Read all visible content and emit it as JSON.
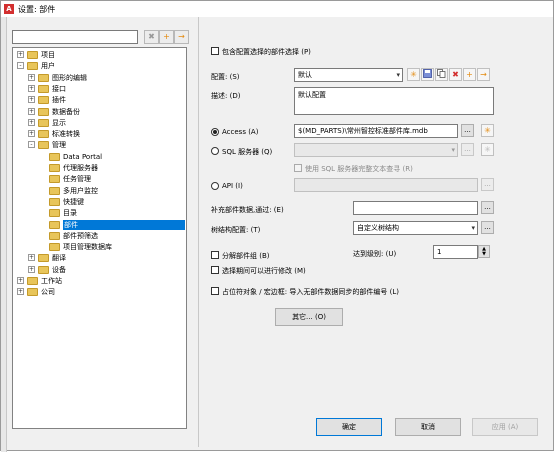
{
  "window": {
    "title": "设置: 部件",
    "app_icon_letter": "A"
  },
  "toolbar": {
    "delete_icon": "✖",
    "add_icon": "+",
    "export_icon": "→"
  },
  "tree": {
    "items": [
      {
        "label": "项目",
        "expander": "+",
        "level": 0
      },
      {
        "label": "用户",
        "expander": "-",
        "level": 0
      },
      {
        "label": "图形的编辑",
        "expander": "+",
        "level": 1
      },
      {
        "label": "接口",
        "expander": "+",
        "level": 1
      },
      {
        "label": "插件",
        "expander": "+",
        "level": 1
      },
      {
        "label": "数据备份",
        "expander": "+",
        "level": 1
      },
      {
        "label": "显示",
        "expander": "+",
        "level": 1
      },
      {
        "label": "标准转换",
        "expander": "+",
        "level": 1
      },
      {
        "label": "管理",
        "expander": "-",
        "level": 1
      },
      {
        "label": "Data Portal",
        "expander": "",
        "level": 2
      },
      {
        "label": "代理服务器",
        "expander": "",
        "level": 2
      },
      {
        "label": "任务管理",
        "expander": "",
        "level": 2
      },
      {
        "label": "多用户监控",
        "expander": "",
        "level": 2
      },
      {
        "label": "快捷键",
        "expander": "",
        "level": 2
      },
      {
        "label": "目录",
        "expander": "",
        "level": 2
      },
      {
        "label": "部件",
        "expander": "",
        "level": 2,
        "selected": true
      },
      {
        "label": "部件预筛选",
        "expander": "",
        "level": 2
      },
      {
        "label": "项目管理数据库",
        "expander": "",
        "level": 2
      },
      {
        "label": "翻译",
        "expander": "+",
        "level": 1
      },
      {
        "label": "设备",
        "expander": "+",
        "level": 1
      },
      {
        "label": "工作站",
        "expander": "+",
        "level": 0
      },
      {
        "label": "公司",
        "expander": "+",
        "level": 0
      }
    ]
  },
  "form": {
    "include_config_label": "包含配置选择的部件选择 (P)",
    "config_label": "配置: (S)",
    "config_value": "默认",
    "desc_label": "描述: (D)",
    "desc_value": "默认配置",
    "access_label": "Access (A)",
    "access_value": "$(MD_PARTS)\\常州智控标准部件库.mdb",
    "sql_label": "SQL 服务器 (Q)",
    "sql_value": "",
    "sql_compat_label": "使用 SQL 服务器完整文本查寻 (R)",
    "api_label": "API (I)",
    "api_value": "",
    "supplement_label": "补充部件数据,通过: (E)",
    "supplement_value": "",
    "struct_label": "树结构配置: (T)",
    "struct_value": "自定义树结构",
    "decompose_label": "分解部件组 (B)",
    "level_label": "达到级别: (U)",
    "level_value": "1",
    "select_period_label": "选择期间可以进行修改 (M)",
    "placeholder_label": "占位符对象 / 宏边框: 导入无部件数据同步的部件编号 (L)",
    "other_button": "其它... (O)",
    "dots": "...",
    "star": "✳"
  },
  "footer": {
    "ok": "确定",
    "cancel": "取消",
    "apply": "应用 (A)"
  },
  "colors": {
    "selection": "#0078d7",
    "folder": "#e8c55a",
    "star": "#e38a0f",
    "delete": "#d32f2f"
  }
}
